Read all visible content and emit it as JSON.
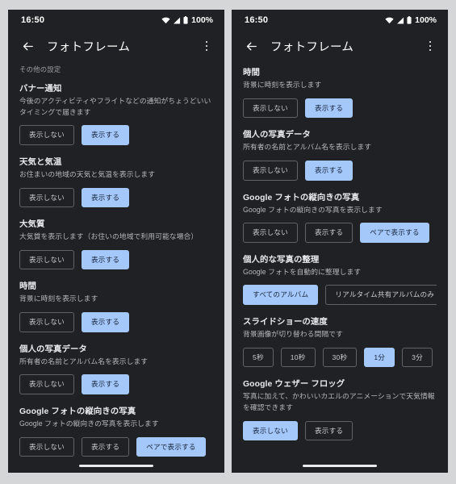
{
  "screens": [
    {
      "id": "left",
      "status": {
        "time": "16:50",
        "wifi_icon": "wifi-icon",
        "signal_icon": "cellular-signal-icon",
        "battery_icon": "battery-full-icon",
        "battery_level": "100%"
      },
      "app_bar": {
        "back_icon": "back-arrow-icon",
        "title": "フォトフレーム",
        "overflow_icon": "overflow-menu-icon"
      },
      "caption": "その他の設定",
      "settings": [
        {
          "title": "バナー通知",
          "desc": "今後のアクティビティやフライトなどの通知がちょうどいいタイミングで届きます",
          "options": [
            {
              "label": "表示しない",
              "selected": false
            },
            {
              "label": "表示する",
              "selected": true
            }
          ]
        },
        {
          "title": "天気と気温",
          "desc": "お住まいの地域の天気と気温を表示します",
          "options": [
            {
              "label": "表示しない",
              "selected": false
            },
            {
              "label": "表示する",
              "selected": true
            }
          ]
        },
        {
          "title": "大気質",
          "desc": "大気質を表示します（お住いの地域で利用可能な場合）",
          "options": [
            {
              "label": "表示しない",
              "selected": false
            },
            {
              "label": "表示する",
              "selected": true
            }
          ]
        },
        {
          "title": "時間",
          "desc": "背景に時刻を表示します",
          "options": [
            {
              "label": "表示しない",
              "selected": false
            },
            {
              "label": "表示する",
              "selected": true
            }
          ]
        },
        {
          "title": "個人の写真データ",
          "desc": "所有者の名前とアルバム名を表示します",
          "options": [
            {
              "label": "表示しない",
              "selected": false
            },
            {
              "label": "表示する",
              "selected": true
            }
          ]
        },
        {
          "title": "Google フォトの縦向きの写真",
          "desc": "Google フォトの縦向きの写真を表示します",
          "options": [
            {
              "label": "表示しない",
              "selected": false
            },
            {
              "label": "表示する",
              "selected": false
            },
            {
              "label": "ペアで表示する",
              "selected": true
            }
          ]
        }
      ]
    },
    {
      "id": "right",
      "status": {
        "time": "16:50",
        "wifi_icon": "wifi-icon",
        "signal_icon": "cellular-signal-icon",
        "battery_icon": "battery-full-icon",
        "battery_level": "100%"
      },
      "app_bar": {
        "back_icon": "back-arrow-icon",
        "title": "フォトフレーム",
        "overflow_icon": "overflow-menu-icon"
      },
      "caption": "",
      "settings": [
        {
          "title": "時間",
          "desc": "背景に時刻を表示します",
          "options": [
            {
              "label": "表示しない",
              "selected": false
            },
            {
              "label": "表示する",
              "selected": true
            }
          ]
        },
        {
          "title": "個人の写真データ",
          "desc": "所有者の名前とアルバム名を表示します",
          "options": [
            {
              "label": "表示しない",
              "selected": false
            },
            {
              "label": "表示する",
              "selected": true
            }
          ]
        },
        {
          "title": "Google フォトの縦向きの写真",
          "desc": "Google フォトの縦向きの写真を表示します",
          "options": [
            {
              "label": "表示しない",
              "selected": false
            },
            {
              "label": "表示する",
              "selected": false
            },
            {
              "label": "ペアで表示する",
              "selected": true
            }
          ]
        },
        {
          "title": "個人的な写真の整理",
          "desc": "Google フォトを自動的に整理します",
          "clipped": true,
          "options": [
            {
              "label": "すべてのアルバム",
              "selected": true
            },
            {
              "label": "リアルタイム共有アルバムのみ",
              "selected": false
            }
          ]
        },
        {
          "title": "スライドショーの速度",
          "desc": "背景画像が切り替わる間隔です",
          "options": [
            {
              "label": "5秒",
              "selected": false
            },
            {
              "label": "10秒",
              "selected": false
            },
            {
              "label": "30秒",
              "selected": false
            },
            {
              "label": "1分",
              "selected": true
            },
            {
              "label": "3分",
              "selected": false
            }
          ]
        },
        {
          "title": "Google ウェザー フロッグ",
          "desc": "写真に加えて、かわいいカエルのアニメーションで天気情報を確認できます",
          "options": [
            {
              "label": "表示しない",
              "selected": true
            },
            {
              "label": "表示する",
              "selected": false
            }
          ]
        }
      ]
    }
  ],
  "colors": {
    "background": "#d4d6d8",
    "surface": "#202124",
    "accent_selected": "#a5c8fa",
    "text_primary": "#e8eaed",
    "text_secondary": "#b4b8bc",
    "outline": "#5f6368"
  }
}
